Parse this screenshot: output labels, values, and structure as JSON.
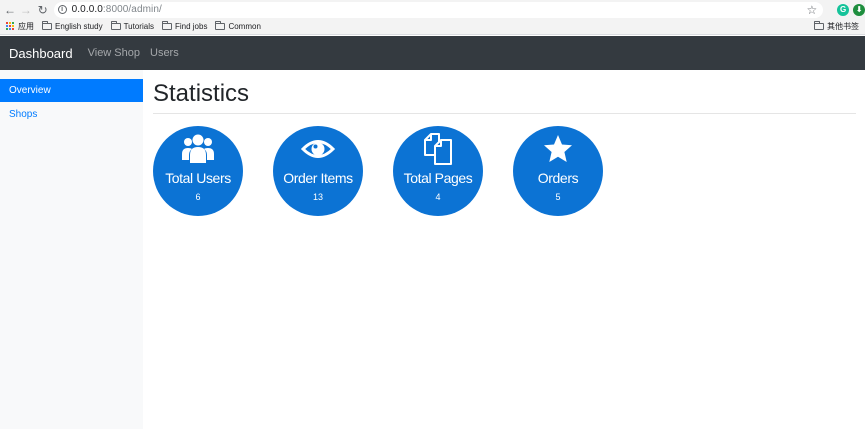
{
  "browser": {
    "url_host": "0.0.0.0",
    "url_path": ":8000/admin/",
    "extension_grammarly": "G",
    "extension_download": "⬇",
    "bookmarks": [
      {
        "label": "应用",
        "icon": "apps-grid-icon"
      },
      {
        "label": "English study",
        "icon": "folder-icon"
      },
      {
        "label": "Tutorials",
        "icon": "folder-icon"
      },
      {
        "label": "Find jobs",
        "icon": "folder-icon"
      },
      {
        "label": "Common",
        "icon": "folder-icon"
      }
    ],
    "other_bookmarks": "其他书签"
  },
  "navbar": {
    "brand": "Dashboard",
    "links": [
      "View Shop",
      "Users"
    ]
  },
  "sidebar": {
    "items": [
      {
        "label": "Overview",
        "active": true
      },
      {
        "label": "Shops",
        "active": false
      }
    ]
  },
  "main": {
    "title": "Statistics",
    "stats": [
      {
        "label": "Total Users",
        "value": "6",
        "icon": "users-icon"
      },
      {
        "label": "Order Items",
        "value": "13",
        "icon": "eye-icon"
      },
      {
        "label": "Total Pages",
        "value": "4",
        "icon": "copy-pages-icon"
      },
      {
        "label": "Orders",
        "value": "5",
        "icon": "star-icon"
      }
    ]
  },
  "colors": {
    "navbar": "#343a40",
    "primary": "#007bff",
    "stat_circle": "#0c73d4",
    "sidebar_bg": "#f8f9fa"
  }
}
